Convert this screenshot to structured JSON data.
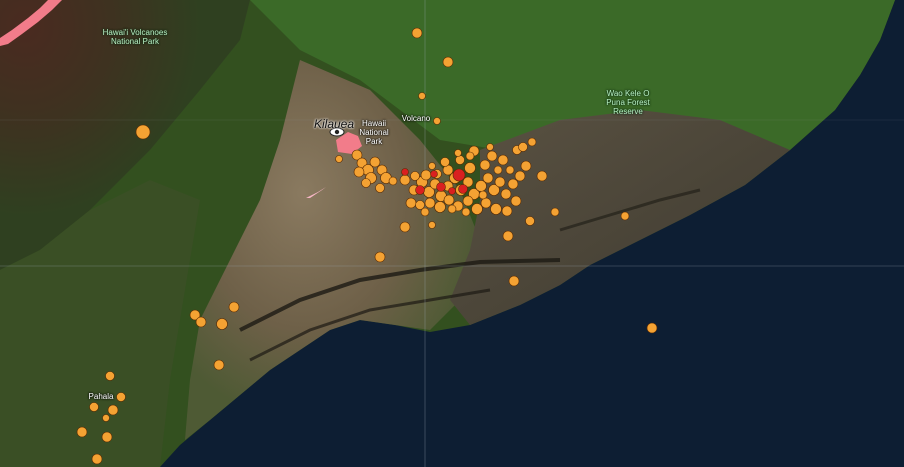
{
  "map": {
    "labels": {
      "hvnp_top": "Hawai'i Volcanoes\nNational Park",
      "hvnp_summit": "Hawaii\nNational\nPark",
      "kilauea": "Kilauea",
      "volcano": "Volcano",
      "wao_kele": "Wao Kele O\nPuna Forest\nReserve",
      "pahala": "Pahala"
    },
    "colors": {
      "ocean": "#0d1e33",
      "land_dark": "#2b3a22",
      "forest": "#3f6b2a",
      "lava_flow": "#4a4438",
      "summit": "#7a6a55",
      "quake_orange": "#f4a233",
      "quake_orange_dark": "#e88a1a",
      "quake_red": "#d92020",
      "lava_pink": "#f27c8a",
      "gridline": "#9aa6b0"
    },
    "icons": [
      "eye-icon"
    ]
  }
}
